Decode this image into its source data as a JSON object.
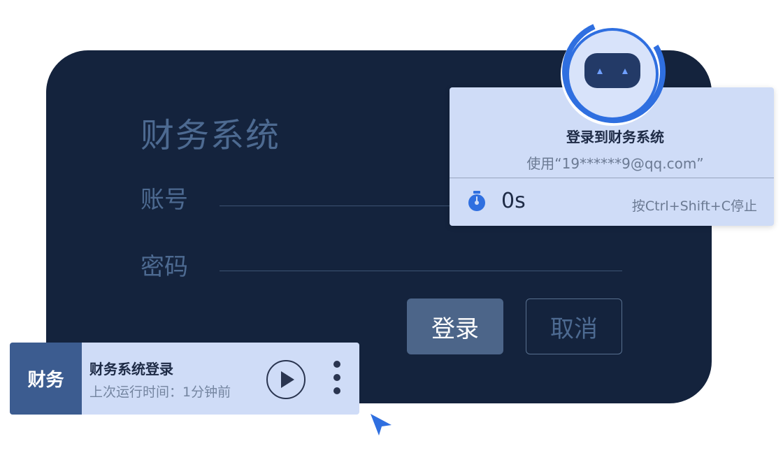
{
  "login": {
    "title": "财务系统",
    "account_label": "账号",
    "password_label": "密码",
    "login_button": "登录",
    "cancel_button": "取消"
  },
  "popup": {
    "title": "登录到财务系统",
    "subtitle": "使用“19******9@qq.com”",
    "timer": "0s",
    "stop_hint": "按Ctrl+Shift+C停止"
  },
  "task": {
    "badge": "财务",
    "name": "财务系统登录",
    "last_run": "上次运行时间：1分钟前"
  },
  "icons": [
    "robot-icon",
    "stopwatch-icon",
    "play-icon",
    "more-vertical-icon",
    "cursor-arrow-icon"
  ],
  "colors": {
    "panel_bg": "#14233d",
    "card_bg": "#cfdcf7",
    "accent_blue": "#2f6fe0",
    "badge_bg": "#3c5c90"
  }
}
